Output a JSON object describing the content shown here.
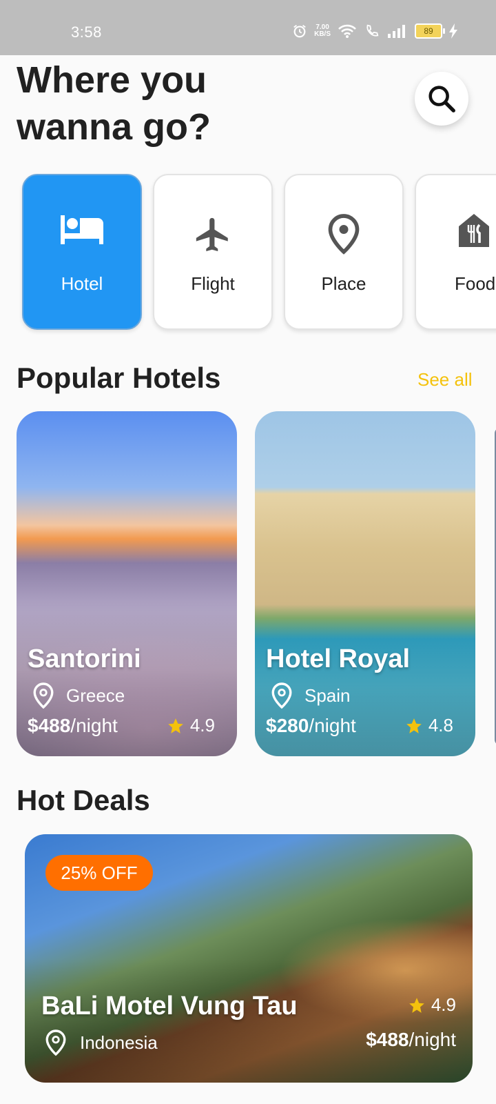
{
  "status_bar": {
    "time": "3:58",
    "net_speed": "7.00",
    "net_unit": "KB/S",
    "battery": "89"
  },
  "header": {
    "title": "Where you wanna go?"
  },
  "categories": [
    {
      "label": "Hotel",
      "icon": "bed-icon",
      "active": true
    },
    {
      "label": "Flight",
      "icon": "airplane-icon",
      "active": false
    },
    {
      "label": "Place",
      "icon": "location-pin-icon",
      "active": false
    },
    {
      "label": "Food",
      "icon": "restaurant-icon",
      "active": false
    }
  ],
  "popular": {
    "title": "Popular Hotels",
    "see_all": "See all",
    "hotels": [
      {
        "name": "Santorini",
        "location": "Greece",
        "price": "$488",
        "unit": "/night",
        "rating": "4.9"
      },
      {
        "name": "Hotel Royal",
        "location": "Spain",
        "price": "$280",
        "unit": "/night",
        "rating": "4.8"
      }
    ]
  },
  "hot_deals": {
    "title": "Hot Deals",
    "deal": {
      "badge": "25% OFF",
      "name": "BaLi Motel Vung Tau",
      "location": "Indonesia",
      "rating": "4.9",
      "price": "$488",
      "unit": "/night"
    }
  },
  "colors": {
    "accent": "#2196f3",
    "link": "#f4c20d",
    "badge": "#ff6f00",
    "star": "#f4c20d"
  }
}
